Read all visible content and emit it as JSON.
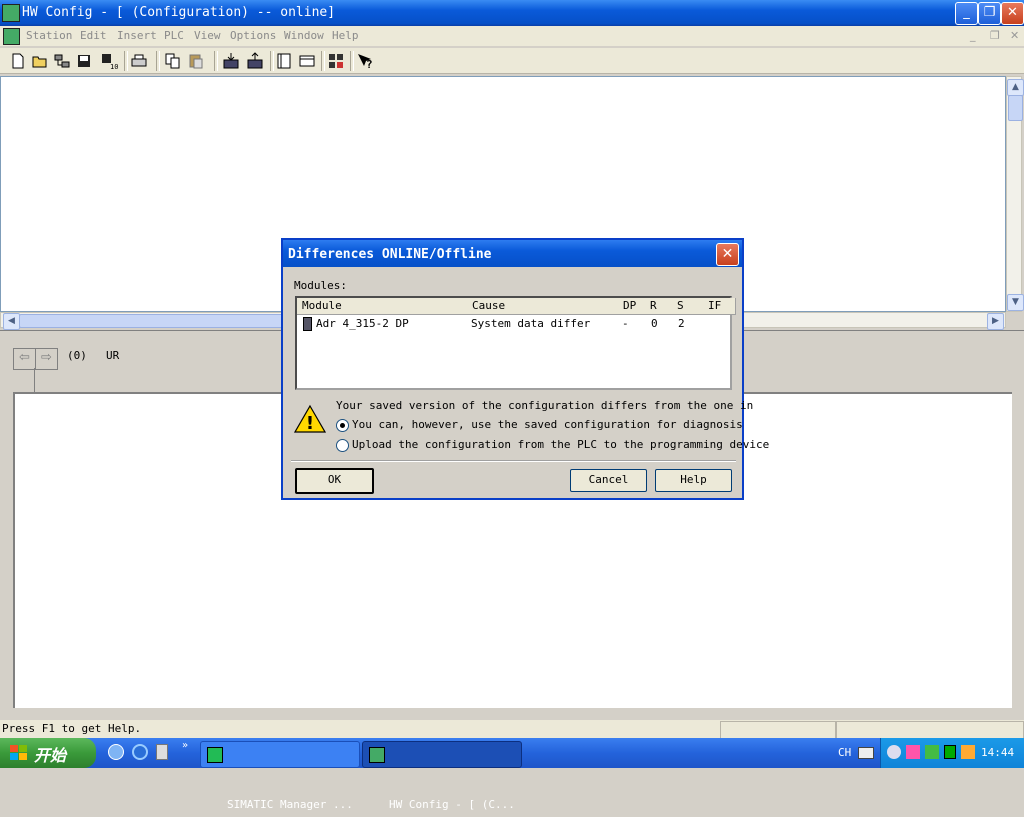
{
  "window": {
    "title": "HW Config - [ (Configuration) -- online]"
  },
  "menu": [
    "Station",
    "Edit",
    "Insert",
    "PLC",
    "View",
    "Options",
    "Window",
    "Help"
  ],
  "toolbar_icons": [
    "new-icon",
    "open-icon",
    "online-icon",
    "save-icon",
    "save-compile-icon",
    "print-icon",
    "copy-icon",
    "paste-icon",
    "download-icon",
    "upload-icon",
    "catalog-icon",
    "network-icon",
    "config-icon",
    "context-help-icon"
  ],
  "rack": {
    "slot": "(0)",
    "name": "UR"
  },
  "status": {
    "text": "Press F1 to get Help."
  },
  "dialog": {
    "title": "Differences ONLINE/Offline",
    "modules_label": "Modules:",
    "columns": [
      "Module",
      "Cause",
      "DP",
      "R",
      "S",
      "IF"
    ],
    "rows": [
      {
        "module": "Adr 4_315-2 DP",
        "cause": "System data differ",
        "dp": "-",
        "r": "0",
        "s": "2",
        "if": ""
      }
    ],
    "message": "Your saved version of the configuration differs from the one in",
    "option1": "You can, however, use the saved configuration for diagnosis",
    "option2": "Upload the configuration from the PLC to the programming device",
    "selected_option": 1,
    "ok": "OK",
    "cancel": "Cancel",
    "help": "Help"
  },
  "taskbar": {
    "start": "开始",
    "tasks": [
      "SIMATIC Manager ...",
      "HW Config - [ (C..."
    ],
    "lang": "CH",
    "clock": "14:44"
  }
}
